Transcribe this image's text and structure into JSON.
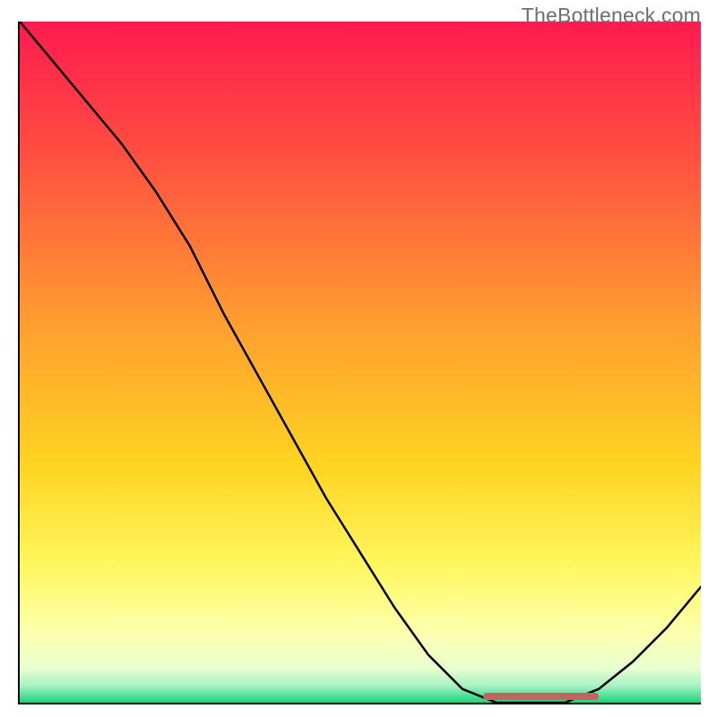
{
  "watermark": "TheBottleneck.com",
  "chart_data": {
    "type": "line",
    "title": "",
    "xlabel": "",
    "ylabel": "",
    "x": [
      0.0,
      0.05,
      0.1,
      0.15,
      0.2,
      0.25,
      0.3,
      0.35,
      0.4,
      0.45,
      0.5,
      0.55,
      0.6,
      0.65,
      0.7,
      0.75,
      0.8,
      0.85,
      0.9,
      0.95,
      1.0
    ],
    "values": [
      100,
      94,
      88,
      82,
      75,
      67,
      57,
      48,
      39,
      30,
      22,
      14,
      7,
      2,
      0,
      0,
      0,
      2,
      6,
      11,
      17
    ],
    "xlim": [
      0,
      1
    ],
    "ylim": [
      0,
      100
    ],
    "annotations": [
      {
        "type": "marker-bar",
        "x_start": 0.68,
        "x_end": 0.85,
        "y": 0.5
      }
    ],
    "gradient_stops": [
      {
        "offset": 0.0,
        "color": "#ff1a4f"
      },
      {
        "offset": 0.2,
        "color": "#ff5040"
      },
      {
        "offset": 0.45,
        "color": "#ffa030"
      },
      {
        "offset": 0.65,
        "color": "#ffd320"
      },
      {
        "offset": 0.8,
        "color": "#fff860"
      },
      {
        "offset": 0.9,
        "color": "#fcffb0"
      },
      {
        "offset": 0.95,
        "color": "#e8ffd0"
      },
      {
        "offset": 0.975,
        "color": "#a8f2c4"
      },
      {
        "offset": 1.0,
        "color": "#18d47a"
      }
    ]
  }
}
